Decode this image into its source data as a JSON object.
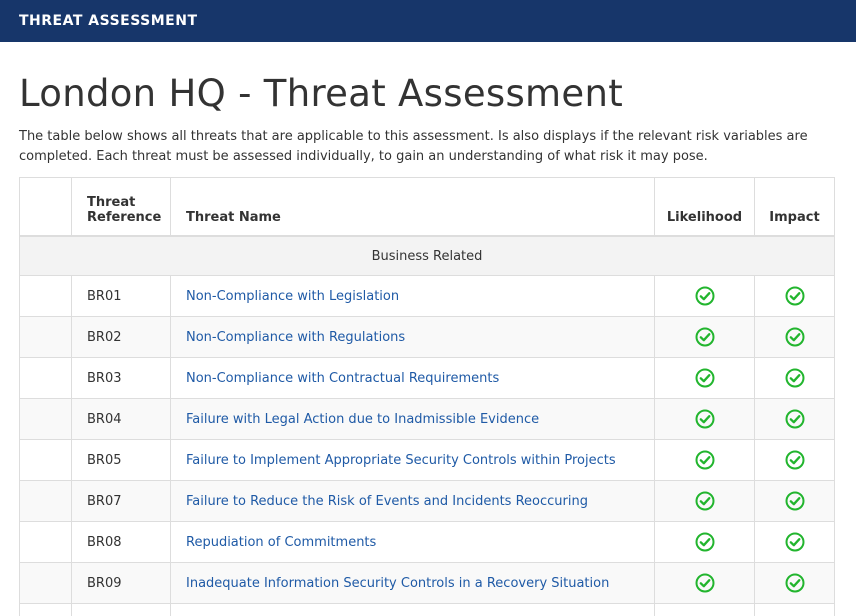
{
  "header": {
    "title": "THREAT ASSESSMENT"
  },
  "page": {
    "title": "London HQ - Threat Assessment",
    "description": "The table below shows all threats that are applicable to this assessment. Is also displays if the relevant risk variables are completed. Each threat must be assessed individually, to gain an understanding of what risk it may pose."
  },
  "table": {
    "columns": {
      "reference_line1": "Threat",
      "reference_line2": "Reference",
      "name": "Threat Name",
      "likelihood": "Likelihood",
      "impact": "Impact"
    },
    "group": "Business Related",
    "status_icon": "check-circle-icon",
    "status_color": "#22b52e",
    "rows": [
      {
        "ref": "BR01",
        "name": "Non-Compliance with Legislation",
        "likelihood": true,
        "impact": true
      },
      {
        "ref": "BR02",
        "name": "Non-Compliance with Regulations",
        "likelihood": true,
        "impact": true
      },
      {
        "ref": "BR03",
        "name": "Non-Compliance with Contractual Requirements",
        "likelihood": true,
        "impact": true
      },
      {
        "ref": "BR04",
        "name": "Failure with Legal Action due to Inadmissible Evidence",
        "likelihood": true,
        "impact": true
      },
      {
        "ref": "BR05",
        "name": "Failure to Implement Appropriate Security Controls within Projects",
        "likelihood": true,
        "impact": true
      },
      {
        "ref": "BR07",
        "name": "Failure to Reduce the Risk of Events and Incidents Reoccuring",
        "likelihood": true,
        "impact": true
      },
      {
        "ref": "BR08",
        "name": "Repudiation of Commitments",
        "likelihood": true,
        "impact": true
      },
      {
        "ref": "BR09",
        "name": "Inadequate Information Security Controls in a Recovery Situation",
        "likelihood": true,
        "impact": true
      }
    ]
  }
}
